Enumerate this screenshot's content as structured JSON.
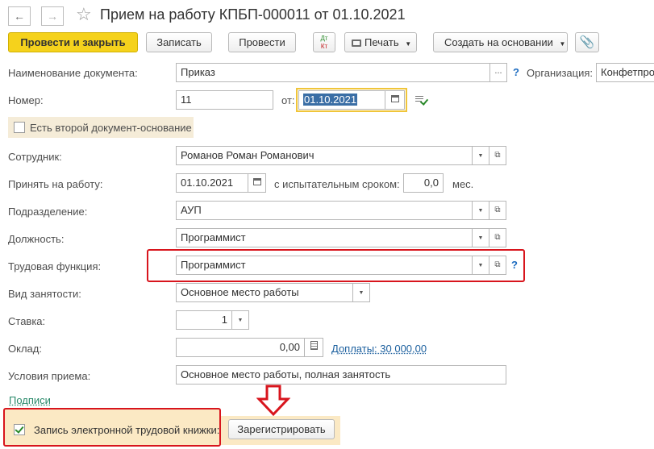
{
  "window": {
    "title": "Прием на работу КПБП-000011 от 01.10.2021",
    "star_icon": "star-icon"
  },
  "toolbar": {
    "post_close": "Провести и закрыть",
    "save": "Записать",
    "post": "Провести",
    "dt_kt_top": "Дт",
    "dt_kt_bottom": "Кт",
    "print": "Печать",
    "create_based": "Создать на основании"
  },
  "form": {
    "doc_name_label": "Наименование документа:",
    "doc_name_value": "Приказ",
    "doc_name_more": "...",
    "org_label": "Организация:",
    "org_value": "Конфетпром",
    "number_label": "Номер:",
    "number_value": "11",
    "from_label": "от:",
    "from_value": "01.10.2021",
    "second_doc_label": "Есть второй документ-основание",
    "employee_label": "Сотрудник:",
    "employee_value": "Романов Роман Романович",
    "hire_label": "Принять на работу:",
    "hire_value": "01.10.2021",
    "trial_label": "с испытательным сроком:",
    "trial_value": "0,0",
    "trial_unit": "мес.",
    "dept_label": "Подразделение:",
    "dept_value": "АУП",
    "position_label": "Должность:",
    "position_value": "Программист",
    "labor_func_label": "Трудовая функция:",
    "labor_func_value": "Программист",
    "employment_label": "Вид занятости:",
    "employment_value": "Основное место работы",
    "rate_label": "Ставка:",
    "rate_value": "1",
    "salary_label": "Оклад:",
    "salary_value": "0,00",
    "salary_link": "Доплаты: 30 000,00",
    "conditions_label": "Условия приема:",
    "conditions_value": "Основное место работы, полная занятость",
    "signatures_link": "Подписи",
    "e_record_label": "Запись электронной трудовой книжки:",
    "register_button": "Зарегистрировать",
    "help_mark": "?"
  },
  "colors": {
    "accent_yellow": "#f5d21c",
    "highlight_red": "#d8151d",
    "link_blue": "#1b5f9e",
    "check_green": "#2a8a2a",
    "panel_beige": "#fbe9c4"
  }
}
